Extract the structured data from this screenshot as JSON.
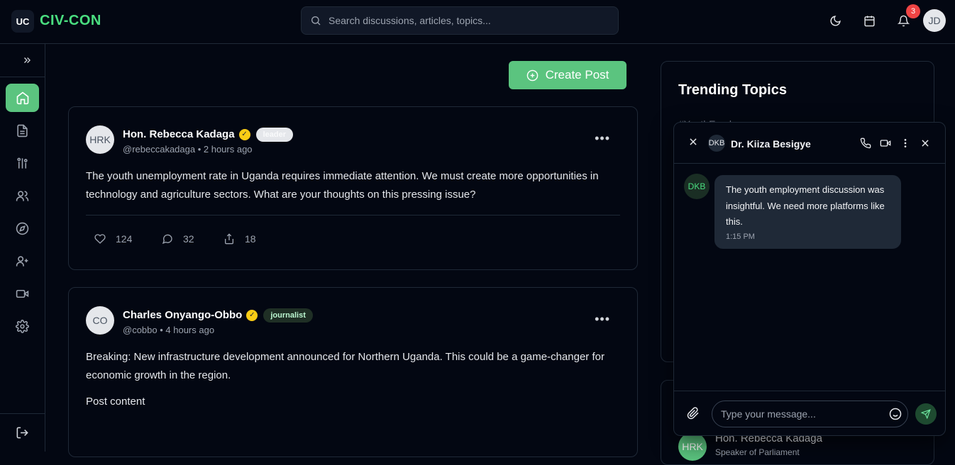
{
  "app": {
    "logo_initials": "UC",
    "name": "CIV-CON"
  },
  "search": {
    "placeholder": "Search discussions, articles, topics..."
  },
  "header": {
    "notification_count": "3",
    "user_initials": "JD",
    "icons": [
      "moon-icon",
      "calendar-icon",
      "bell-icon"
    ]
  },
  "sidebar": {
    "expand_icon": "chevrons-right-icon",
    "items": [
      "home",
      "articles",
      "topics",
      "community",
      "explore",
      "add-user",
      "video",
      "settings"
    ],
    "active": "home",
    "logout_icon": "logout-icon"
  },
  "main": {
    "create_post_label": "Create Post"
  },
  "posts": [
    {
      "initials": "HRK",
      "author": "Hon. Rebecca Kadaga",
      "role": "leader",
      "handle_time": "@rebeccakadaga • 2 hours ago",
      "text": "The youth unemployment rate in Uganda requires immediate attention. We must create more opportunities in technology and agriculture sectors. What are your thoughts on this pressing issue?",
      "likes": "124",
      "comments": "32",
      "shares": "18"
    },
    {
      "initials": "CO",
      "author": "Charles Onyango-Obbo",
      "role": "journalist",
      "handle_time": "@cobbo • 4 hours ago",
      "text": "Breaking: New infrastructure development announced for Northern Uganda. This could be a game-changer for economic growth in the region.",
      "extra": "Post content"
    }
  ],
  "trending": {
    "title": "Trending Topics",
    "first_item": "#YouthEmploym..."
  },
  "suggested": {
    "initials": "HRK",
    "name": "Hon. Rebecca Kadaga",
    "subtitle": "Speaker of Parliament"
  },
  "chat": {
    "contact_initials": "DKB",
    "contact_name": "Dr. Kiiza Besigye",
    "messages": [
      {
        "initials": "DKB",
        "text": "The youth employment discussion was insightful. We need more platforms like this.",
        "time": "1:15 PM"
      }
    ],
    "input_placeholder": "Type your message..."
  },
  "colors": {
    "accent": "#5bc47f",
    "background": "#030712",
    "badge": "#ef4444",
    "verified": "#facc15"
  }
}
